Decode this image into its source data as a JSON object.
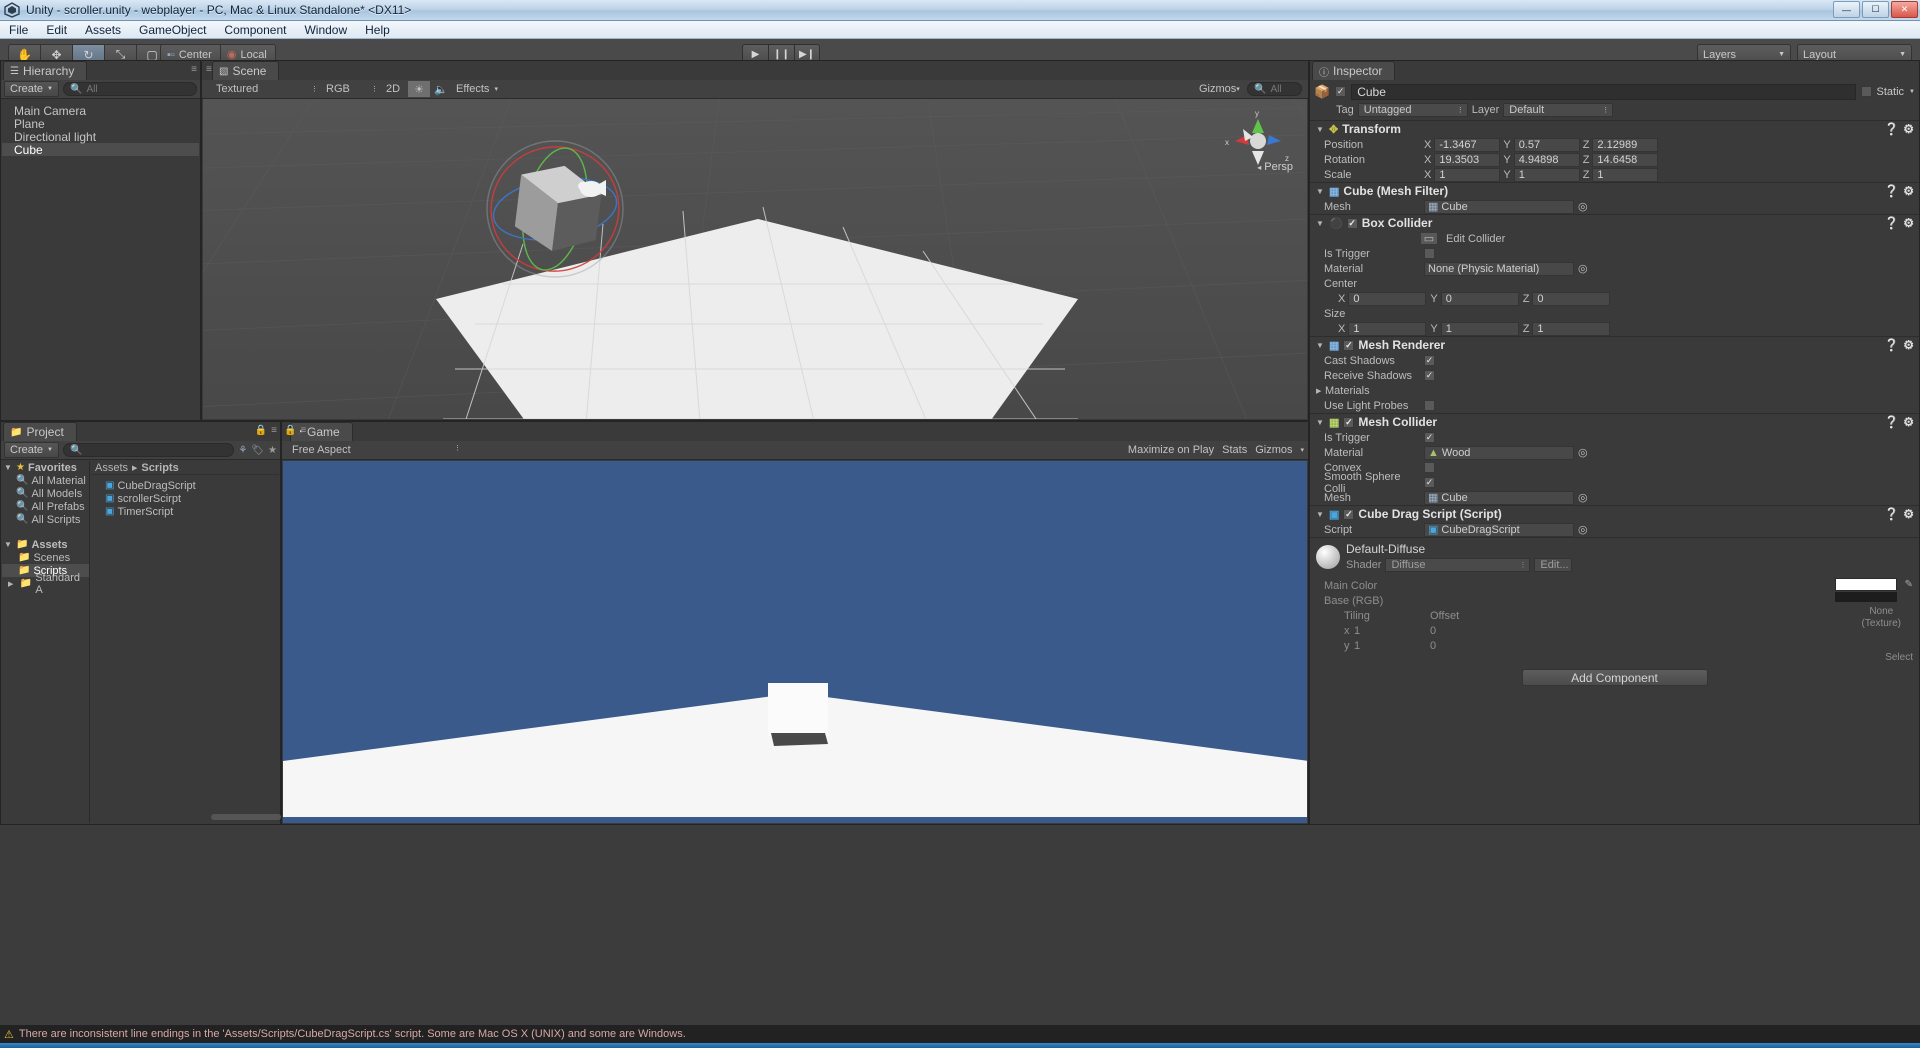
{
  "window": {
    "title": "Unity - scroller.unity - webplayer - PC, Mac & Linux Standalone* <DX11>",
    "logo_icon": "unity-logo-icon",
    "minimize": "—",
    "maximize": "☐",
    "close": "✕"
  },
  "menubar": {
    "items": [
      "File",
      "Edit",
      "Assets",
      "GameObject",
      "Component",
      "Window",
      "Help"
    ]
  },
  "toolbar": {
    "tools": [
      {
        "name": "hand-tool-icon",
        "glyph": "✋",
        "selected": false
      },
      {
        "name": "move-tool-icon",
        "glyph": "✥",
        "selected": false
      },
      {
        "name": "rotate-tool-icon",
        "glyph": "↻",
        "selected": true
      },
      {
        "name": "scale-tool-icon",
        "glyph": "⤡",
        "selected": false
      },
      {
        "name": "rect-tool-icon",
        "glyph": "▢",
        "selected": false
      }
    ],
    "pivot_label": "Center",
    "space_label": "Local",
    "play_label": "▶",
    "pause_label": "❙❙",
    "step_label": "▶❙",
    "layers_label": "Layers",
    "layout_label": "Layout"
  },
  "hierarchy": {
    "tab_label": "Hierarchy",
    "tab_icon": "hierarchy-icon",
    "create_label": "Create",
    "search_placeholder": "All",
    "items": [
      {
        "label": "Main Camera",
        "selected": false
      },
      {
        "label": "Plane",
        "selected": false
      },
      {
        "label": "Directional light",
        "selected": false
      },
      {
        "label": "Cube",
        "selected": true
      }
    ]
  },
  "scene": {
    "tab_label": "Scene",
    "tab_icon": "scene-icon",
    "draw_mode": "Textured",
    "color_mode": "RGB",
    "mode_2d": "2D",
    "lighting_icon": "sun-icon",
    "audio_icon": "speaker-icon",
    "effects_label": "Effects",
    "gizmos_label": "Gizmos",
    "search_placeholder": "All",
    "persp_label": "Persp",
    "axis_x": "x",
    "axis_y": "y",
    "axis_z": "z"
  },
  "project": {
    "tab_label": "Project",
    "tab_icon": "folder-icon",
    "create_label": "Create",
    "search_placeholder": "",
    "favorites_label": "Favorites",
    "favorites": [
      "All Material",
      "All Models",
      "All Prefabs",
      "All Scripts"
    ],
    "assets_label": "Assets",
    "folders": [
      {
        "label": "Scenes",
        "selected": false,
        "expandable": false
      },
      {
        "label": "Scripts",
        "selected": true,
        "expandable": false
      },
      {
        "label": "Standard A",
        "selected": false,
        "expandable": true
      }
    ],
    "breadcrumb": [
      "Assets",
      "Scripts"
    ],
    "files": [
      "CubeDragScript",
      "scrollerScirpt",
      "TimerScript"
    ]
  },
  "game": {
    "tab_label": "Game",
    "tab_icon": "game-icon",
    "aspect_label": "Free Aspect",
    "maximize_label": "Maximize on Play",
    "stats_label": "Stats",
    "gizmos_label": "Gizmos"
  },
  "inspector": {
    "tab_label": "Inspector",
    "tab_icon": "info-icon",
    "object_name": "Cube",
    "object_enabled": true,
    "static_label": "Static",
    "tag_label": "Tag",
    "tag_value": "Untagged",
    "layer_label": "Layer",
    "layer_value": "Default",
    "components": [
      {
        "name": "Transform",
        "icon": "transform-icon",
        "has_checkbox": false,
        "rows": [
          {
            "label": "Position",
            "axes": [
              {
                "a": "X",
                "v": "-1.3467"
              },
              {
                "a": "Y",
                "v": "0.57"
              },
              {
                "a": "Z",
                "v": "2.12989"
              }
            ]
          },
          {
            "label": "Rotation",
            "axes": [
              {
                "a": "X",
                "v": "19.3503"
              },
              {
                "a": "Y",
                "v": "4.94898"
              },
              {
                "a": "Z",
                "v": "14.6458"
              }
            ]
          },
          {
            "label": "Scale",
            "axes": [
              {
                "a": "X",
                "v": "1"
              },
              {
                "a": "Y",
                "v": "1"
              },
              {
                "a": "Z",
                "v": "1"
              }
            ]
          }
        ]
      },
      {
        "name": "Cube (Mesh Filter)",
        "icon": "mesh-filter-icon",
        "has_checkbox": false,
        "objrows": [
          {
            "label": "Mesh",
            "value": "Cube",
            "icon": "mesh-icon"
          }
        ]
      },
      {
        "name": "Box Collider",
        "icon": "box-collider-icon",
        "has_checkbox": true,
        "checked": true,
        "edit_collider_label": "Edit Collider",
        "edit_collider_icon": "edit-collider-icon",
        "checkrows": [
          {
            "label": "Is Trigger",
            "checked": false
          }
        ],
        "objrows": [
          {
            "label": "Material",
            "value": "None (Physic Material)",
            "icon": ""
          }
        ],
        "vec_label_center": "Center",
        "center": [
          {
            "a": "X",
            "v": "0"
          },
          {
            "a": "Y",
            "v": "0"
          },
          {
            "a": "Z",
            "v": "0"
          }
        ],
        "vec_label_size": "Size",
        "size": [
          {
            "a": "X",
            "v": "1"
          },
          {
            "a": "Y",
            "v": "1"
          },
          {
            "a": "Z",
            "v": "1"
          }
        ]
      },
      {
        "name": "Mesh Renderer",
        "icon": "mesh-renderer-icon",
        "has_checkbox": true,
        "checked": true,
        "checkrows": [
          {
            "label": "Cast Shadows",
            "checked": true
          },
          {
            "label": "Receive Shadows",
            "checked": true
          }
        ],
        "fold_label": "Materials",
        "lastcheck": {
          "label": "Use Light Probes",
          "checked": false
        }
      },
      {
        "name": "Mesh Collider",
        "icon": "mesh-collider-icon",
        "has_checkbox": true,
        "checked": true,
        "checkrows": [
          {
            "label": "Is Trigger",
            "checked": true
          }
        ],
        "objrows": [
          {
            "label": "Material",
            "value": "Wood",
            "icon": "physic-material-icon"
          }
        ],
        "checkrows2": [
          {
            "label": "Convex",
            "checked": false
          },
          {
            "label": "Smooth Sphere Colli",
            "checked": true
          }
        ],
        "objrows2": [
          {
            "label": "Mesh",
            "value": "Cube",
            "icon": "mesh-icon"
          }
        ]
      },
      {
        "name": "Cube Drag Script (Script)",
        "icon": "cs-script-icon",
        "has_checkbox": true,
        "checked": true,
        "objrows": [
          {
            "label": "Script",
            "value": "CubeDragScript",
            "icon": "cs-script-icon"
          }
        ]
      }
    ],
    "material": {
      "name": "Default-Diffuse",
      "shader_label": "Shader",
      "shader_value": "Diffuse",
      "edit_label": "Edit...",
      "main_color_label": "Main Color",
      "base_rgb_label": "Base (RGB)",
      "tiling_label": "Tiling",
      "offset_label": "Offset",
      "tiling_x_label": "x",
      "tiling_x_value": "1",
      "tiling_y_label": "y",
      "tiling_y_value": "1",
      "offset_x_value": "0",
      "offset_y_value": "0",
      "texture_none_label": "None",
      "texture_type_label": "(Texture)",
      "select_label": "Select",
      "color_swatch": "#ffffff"
    },
    "add_component_label": "Add Component"
  },
  "statusbar": {
    "warning_icon": "warning-triangle-icon",
    "message": "There are inconsistent line endings in the 'Assets/Scripts/CubeDragScript.cs' script. Some are Mac OS X (UNIX) and some are Windows."
  },
  "colors": {
    "panel_bg": "#3a3a3a",
    "scene_bg": "#4c4c4c",
    "game_sky": "#3b5a8c",
    "selection": "#4d4d4d",
    "axis_x": "#d23b3b",
    "axis_y": "#5fc44a",
    "axis_z": "#3b78d2"
  }
}
